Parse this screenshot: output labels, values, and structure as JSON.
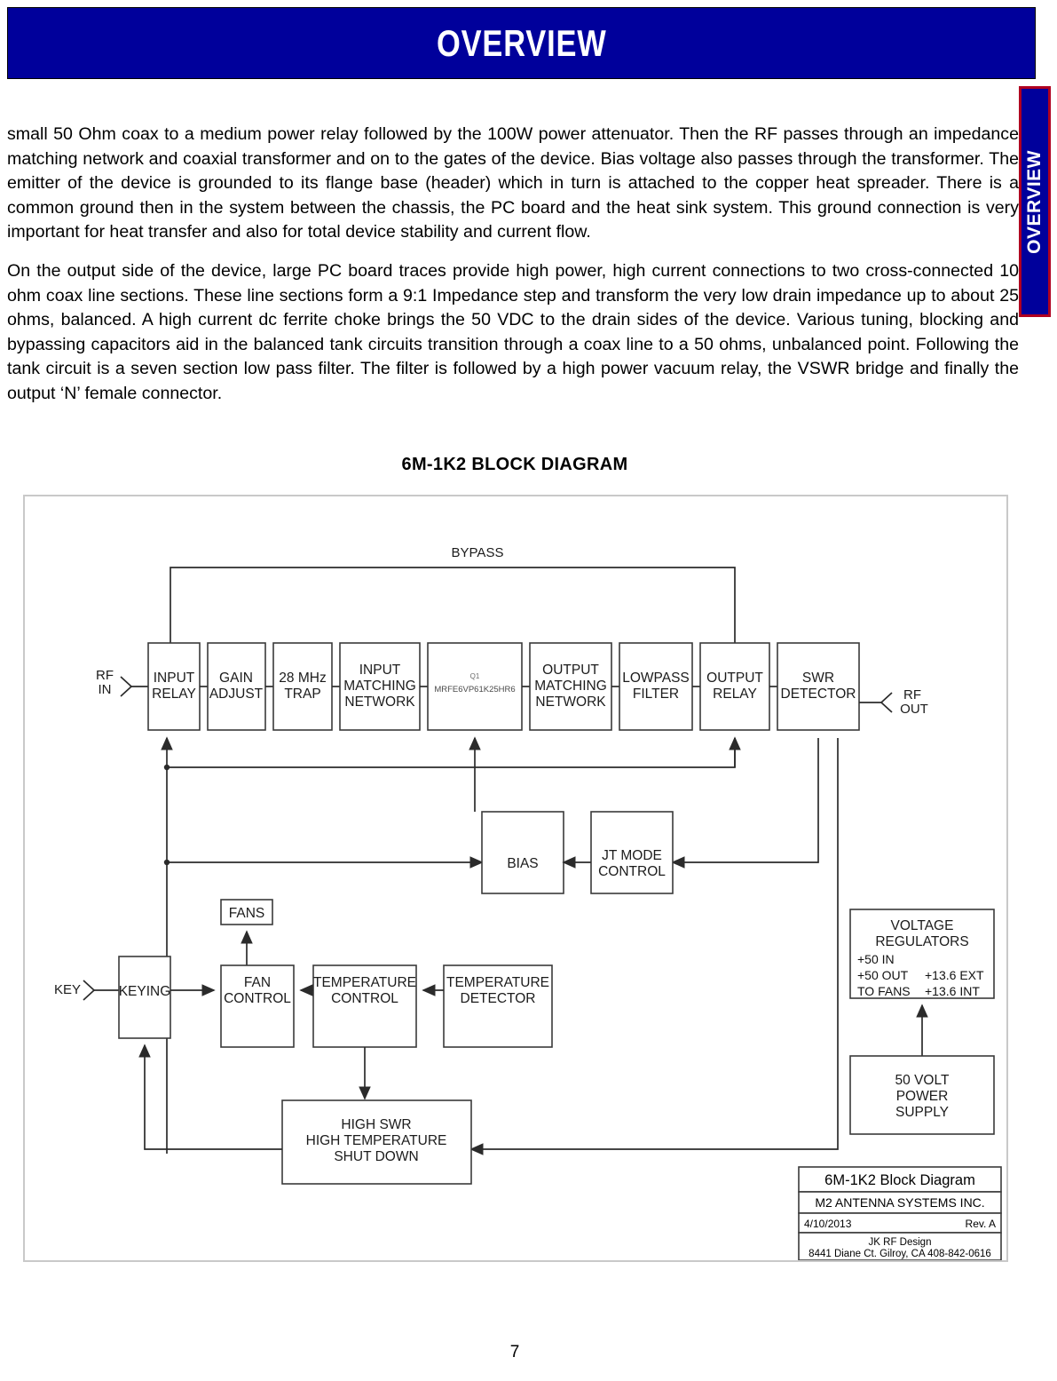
{
  "header": {
    "title": "OVERVIEW"
  },
  "side_tab": {
    "label": "OVERVIEW",
    "bg_color": "#00009B",
    "border_color": "#B00020"
  },
  "body": {
    "paragraph_1": "small 50 Ohm coax to a medium power relay followed by the 100W power attenuator.  Then the RF passes through an impedance matching network and coaxial transformer and on to the gates of the device.  Bias voltage also passes through the transformer.  The emitter of the device is grounded to its flange base (header) which in turn is attached to the copper heat spreader. There is a common ground then in the system between the chassis, the  PC board and the heat sink system. This ground connection is very important for heat transfer and also for total device stability and current flow.",
    "paragraph_2": "On the output side of the device, large PC board traces provide high power, high current connections to two cross-connected 10 ohm coax line sections. These line sections form a 9:1 Impedance step and transform the very low drain impedance up to about 25 ohms, balanced. A high current dc ferrite choke brings the 50 VDC to the drain sides of the device. Various tuning, blocking and bypassing capacitors aid in the balanced tank circuits transition through a coax line to a 50 ohms, unbalanced point.  Following the tank circuit is a seven section low pass filter.  The filter is followed by a high power vacuum relay, the VSWR bridge and finally the output ‘N’ female connector."
  },
  "diagram": {
    "title": "6M-1K2 BLOCK DIAGRAM",
    "bypass_label": "BYPASS",
    "io": {
      "rf_in_line1": "RF",
      "rf_in_line2": "IN",
      "rf_out_line1": "RF",
      "rf_out_line2": "OUT",
      "key": "KEY"
    },
    "signal_chain": [
      {
        "id": "input-relay",
        "line1": "INPUT",
        "line2": "RELAY",
        "line3": ""
      },
      {
        "id": "gain-adjust",
        "line1": "GAIN",
        "line2": "ADJUST",
        "line3": ""
      },
      {
        "id": "28mhz-trap",
        "line1": "28 MHz",
        "line2": "TRAP",
        "line3": ""
      },
      {
        "id": "input-matching",
        "line1": "INPUT",
        "line2": "MATCHING",
        "line3": "NETWORK"
      },
      {
        "id": "q1-device",
        "line1": "Q1",
        "line2": "MRFE6VP61K25HR6",
        "line3": ""
      },
      {
        "id": "output-matching",
        "line1": "OUTPUT",
        "line2": "MATCHING",
        "line3": "NETWORK"
      },
      {
        "id": "lowpass-filter",
        "line1": "LOWPASS",
        "line2": "FILTER",
        "line3": ""
      },
      {
        "id": "output-relay",
        "line1": "OUTPUT",
        "line2": "RELAY",
        "line3": ""
      },
      {
        "id": "swr-detector",
        "line1": "SWR",
        "line2": "DETECTOR",
        "line3": ""
      }
    ],
    "bias_block": "BIAS",
    "jt_mode_block_line1": "JT MODE",
    "jt_mode_block_line2": "CONTROL",
    "fans_block": "FANS",
    "keying_block": "KEYING",
    "fan_control_line1": "FAN",
    "fan_control_line2": "CONTROL",
    "temp_control_line1": "TEMPERATURE",
    "temp_control_line2": "CONTROL",
    "temp_detector_line1": "TEMPERATURE",
    "temp_detector_line2": "DETECTOR",
    "shutdown_line1": "HIGH SWR",
    "shutdown_line2": "HIGH TEMPERATURE",
    "shutdown_line3": "SHUT DOWN",
    "voltage_regulators": {
      "title_line1": "VOLTAGE",
      "title_line2": "REGULATORS",
      "rows": [
        {
          "left": "+50 IN",
          "right": ""
        },
        {
          "left": "+50 OUT",
          "right": "+13.6 EXT"
        },
        {
          "left": "TO FANS",
          "right": "+13.6 INT"
        }
      ]
    },
    "power_supply_line1": "50 VOLT",
    "power_supply_line2": "POWER",
    "power_supply_line3": "SUPPLY",
    "title_block": {
      "drawing_title": "6M-1K2 Block Diagram",
      "company": "M2 ANTENNA SYSTEMS INC.",
      "date": "4/10/2013",
      "revision": "Rev. A",
      "designer": "JK RF Design",
      "address": "8441 Diane Ct. Gilroy, CA  408-842-0616"
    }
  },
  "footer": {
    "page_number": "7"
  }
}
